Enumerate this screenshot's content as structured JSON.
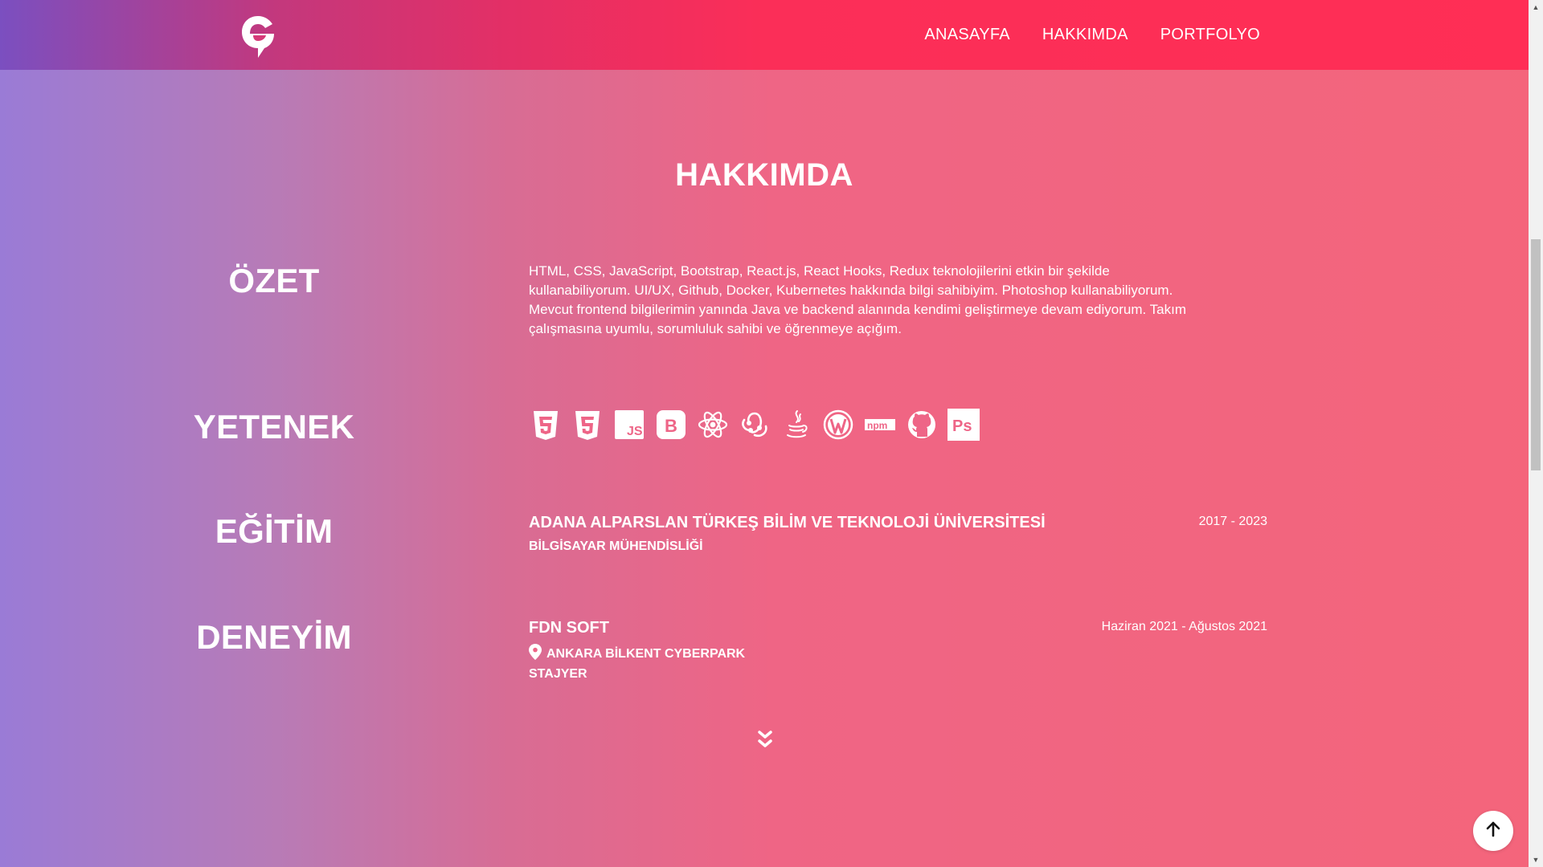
{
  "nav": {
    "logo_icon": "e-logo-icon",
    "links": [
      "ANASAYFA",
      "HAKKIMDA",
      "PORTFOLYO"
    ]
  },
  "about": {
    "title": "HAKKIMDA",
    "summary_heading": "ÖZET",
    "summary_text": "HTML, CSS, JavaScript, Bootstrap, React.js, React Hooks, Redux teknolojilerini etkin bir şekilde kullanabiliyorum. UI/UX, Github, Docker, Kubernetes hakkında bilgi sahibiyim. Photoshop kullanabiliyorum. Mevcut frontend bilgilerimin yanında Java ve backend alanında kendimi geliştirmeye devam ediyorum. Takım çalışmasına uyumlu, sorumluluk sahibi ve öğrenmeye açığım.",
    "skills_heading": "YETENEK",
    "skills": [
      "html5-icon",
      "css3-icon",
      "javascript-icon",
      "bootstrap-icon",
      "react-icon",
      "redux-icon",
      "java-icon",
      "wordpress-icon",
      "npm-icon",
      "github-icon",
      "photoshop-icon"
    ],
    "education_heading": "EĞİTİM",
    "education": {
      "school": "ADANA ALPARSLAN TÜRKEŞ BİLİM VE TEKNOLOJİ ÜNİVERSİTESİ",
      "department": "BİLGİSAYAR MÜHENDİSLİĞİ",
      "dates": "2017 - 2023"
    },
    "experience_heading": "DENEYİM",
    "experience": {
      "company": "FDN SOFT",
      "location": "ANKARA BİLKENT CYBERPARK",
      "role": "STAJYER",
      "dates": "Haziran 2021 - Ağustos 2021"
    }
  },
  "colors": {
    "nav_gradient": [
      "#7b4fc0",
      "#ff2e55"
    ],
    "page_gradient": [
      "#9a7bd6",
      "#f4657b"
    ]
  }
}
